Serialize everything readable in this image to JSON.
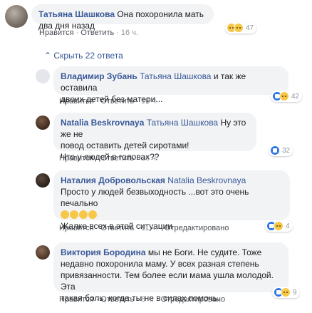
{
  "top_comment": {
    "author": "Татьяна Шашкова",
    "text": "Она похоронила мать два дня назад",
    "like": "Нравится",
    "reply": "Ответить",
    "time": "16 ч.",
    "reactions": [
      "sad-icon",
      "sad-icon"
    ],
    "reaction_count": "47"
  },
  "hide_replies": "Скрыть 22 ответа",
  "replies": [
    {
      "author": "Владимир Зубань",
      "mention": "Татьяна Шашкова",
      "line1": "и так же оставила",
      "line2": "двоих детей без матери...",
      "like": "Нравится",
      "reply": "Ответить",
      "time": "16 ч.",
      "reactions": [
        "like-icon",
        "sad-icon"
      ],
      "reaction_count": "42"
    },
    {
      "author": "Natalia Beskrovnaya",
      "mention": "Татьяна Шашкова",
      "line1": "Ну это же не",
      "line2": "повод оставить детей сиротами!",
      "line3": "Что у людей в головах??",
      "like": "Нравится",
      "reply": "Ответить",
      "time": "16 ч.",
      "reactions": [
        "like-icon"
      ],
      "reaction_count": "32"
    },
    {
      "author": "Наталия Добровольская",
      "mention": "Natalia Beskrovnaya",
      "line1": "Просто у людей безвыходность ...вот это очень печально",
      "line3": "Жалко всех в этой ситуации",
      "like": "Нравится",
      "reply": "Ответить",
      "time": "11 ч.",
      "edited": "Отредактировано",
      "reactions": [
        "like-icon",
        "sad-icon"
      ],
      "reaction_count": "4"
    },
    {
      "author": "Виктория Бородина",
      "line1": "мы не Боги. Не судите. Тоже",
      "line2": "недавно похоронила маму. У всех разная степень",
      "line3": "привязанности. Тем более если мама ушла молодой. Эта",
      "line4": "такая боль, когда ты не в силах помочь.",
      "like": "Нравится",
      "reply": "Ответить",
      "time": "8 ч.",
      "edited": "Отредактировано",
      "reactions": [
        "like-icon",
        "sad-icon"
      ],
      "reaction_count": "9"
    }
  ]
}
